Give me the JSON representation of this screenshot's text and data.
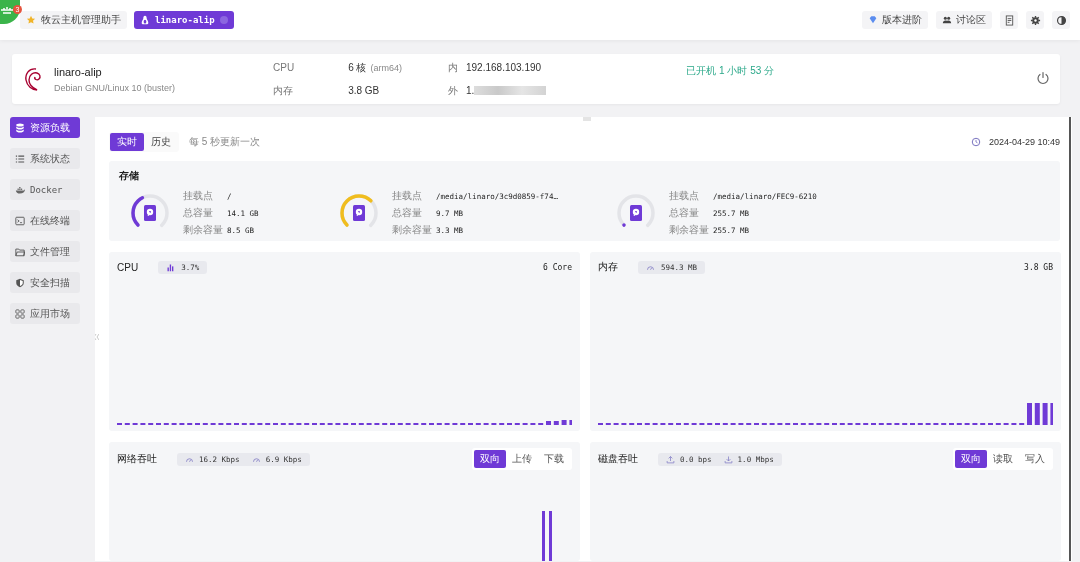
{
  "app_badge": {
    "count": "3"
  },
  "tabs": [
    {
      "label": "牧云主机管理助手",
      "kind": "home",
      "selected": false
    },
    {
      "label": "linaro-alip",
      "kind": "host",
      "selected": true
    }
  ],
  "toolbar": {
    "buttons": [
      {
        "label": "版本进阶",
        "kind": "gem"
      },
      {
        "label": "讨论区",
        "kind": "group"
      }
    ]
  },
  "host": {
    "name": "linaro-alip",
    "os": "Debian GNU/Linux 10 (buster)",
    "cpu_label": "CPU",
    "cpu_value": "6 核",
    "cpu_arch": "(arm64)",
    "memory_label": "内存",
    "memory_value": "3.8 GB",
    "lan_label": "内",
    "lan_ip": "192.168.103.190",
    "wan_label": "外",
    "wan_ip": "1.",
    "uptime": "已开机 1 小时 53 分"
  },
  "sidebar": {
    "items": [
      {
        "label": "资源负载",
        "kind": "database",
        "selected": true
      },
      {
        "label": "系统状态",
        "kind": "list",
        "selected": false
      },
      {
        "label": "Docker",
        "kind": "docker",
        "selected": false
      },
      {
        "label": "在线终端",
        "kind": "terminal",
        "selected": false
      },
      {
        "label": "文件管理",
        "kind": "folder",
        "selected": false
      },
      {
        "label": "安全扫描",
        "kind": "shield",
        "selected": false
      },
      {
        "label": "应用市场",
        "kind": "apps",
        "selected": false
      }
    ]
  },
  "view_tabs": [
    {
      "label": "实时",
      "selected": true
    },
    {
      "label": "历史",
      "selected": false
    }
  ],
  "refresh_note": "每 5 秒更新一次",
  "timestamp": "2024-04-29 10:49",
  "storage": {
    "title": "存储",
    "disks": [
      {
        "level": 0.4,
        "color": "#6f3ad6",
        "fields": [
          {
            "label": "挂载点",
            "value": "/"
          },
          {
            "label": "总容量",
            "value": "14.1 GB"
          },
          {
            "label": "剩余容量",
            "value": "8.5 GB"
          }
        ]
      },
      {
        "level": 0.66,
        "color": "#f0bd1e",
        "fields": [
          {
            "label": "挂载点",
            "value": "/media/linaro/3c9d0859-f74…"
          },
          {
            "label": "总容量",
            "value": "9.7 MB"
          },
          {
            "label": "剩余容量",
            "value": "3.3 MB"
          }
        ]
      },
      {
        "level": 0,
        "color": "#6f3ad6",
        "fields": [
          {
            "label": "挂载点",
            "value": "/media/linaro/FEC9-6210"
          },
          {
            "label": "总容量",
            "value": "255.7 MB"
          },
          {
            "label": "剩余容量",
            "value": "255.7 MB"
          }
        ]
      }
    ]
  },
  "cpu": {
    "title": "CPU",
    "usage": "3.7%",
    "total": "6 Core"
  },
  "memory": {
    "title": "内存",
    "usage": "594.3 MB",
    "total": "3.8 GB"
  },
  "network": {
    "title": "网络吞吐",
    "rates": [
      {
        "kind": "gauge",
        "value": "16.2 Kbps"
      },
      {
        "kind": "gauge",
        "value": "6.9 Kbps"
      }
    ],
    "modes": [
      {
        "label": "双向",
        "selected": true
      },
      {
        "label": "上传",
        "selected": false
      },
      {
        "label": "下载",
        "selected": false
      }
    ]
  },
  "disk_io": {
    "title": "磁盘吞吐",
    "rates": [
      {
        "kind": "upload",
        "value": "0.0 bps"
      },
      {
        "kind": "download",
        "value": "1.0 Mbps"
      }
    ],
    "modes": [
      {
        "label": "双向",
        "selected": true
      },
      {
        "label": "读取",
        "selected": false
      },
      {
        "label": "写入",
        "selected": false
      }
    ]
  }
}
